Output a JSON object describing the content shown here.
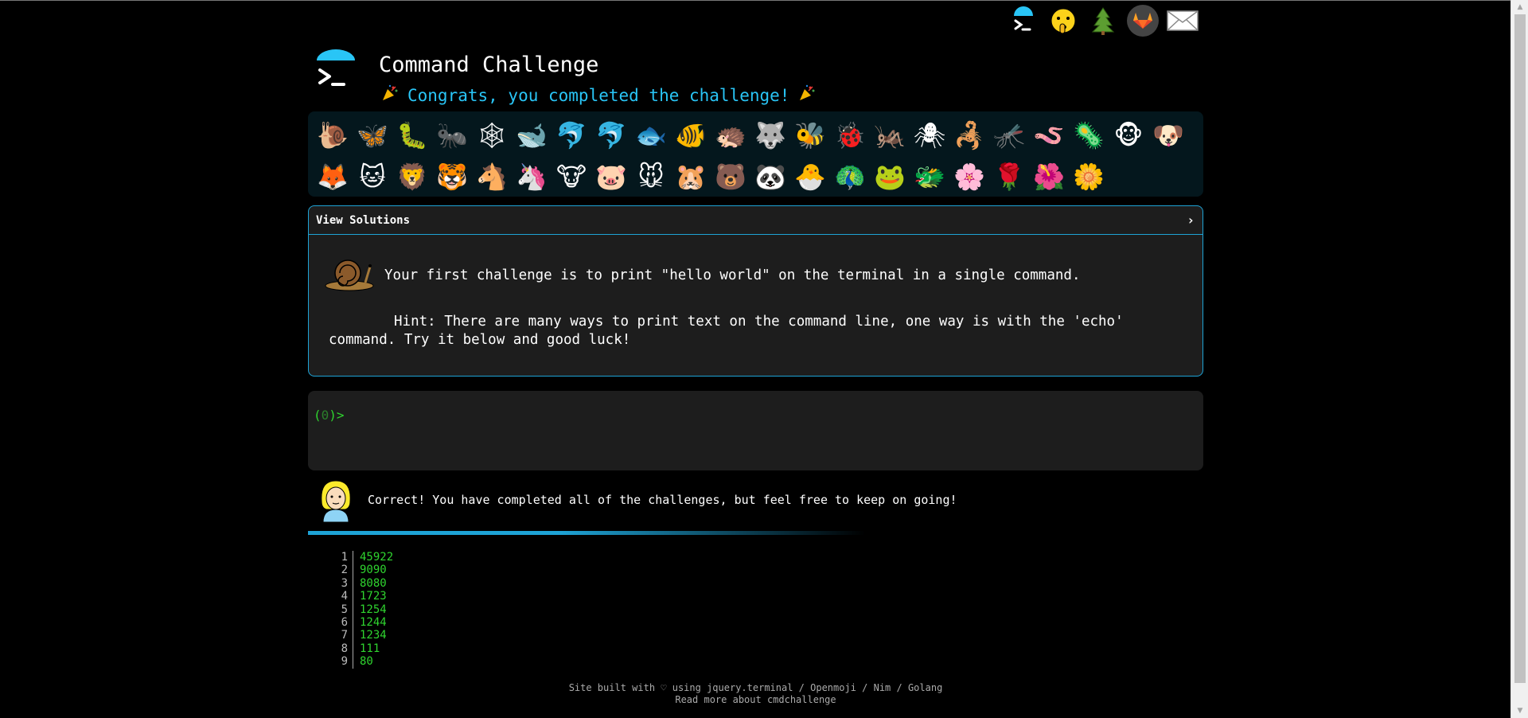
{
  "header": {
    "title": "Command Challenge",
    "subtitle": "Congrats, you completed the challenge!"
  },
  "top_links": [
    {
      "name": "terminal-icon"
    },
    {
      "name": "shushing-face-icon"
    },
    {
      "name": "evergreen-tree-icon"
    },
    {
      "name": "gitlab-icon"
    },
    {
      "name": "envelope-icon"
    }
  ],
  "animals": [
    "🐌",
    "🦋",
    "🐛",
    "🐜",
    "🕸",
    "🐋",
    "🐬",
    "🐬",
    "🐟",
    "🐠",
    "🦔",
    "🐺",
    "🐝",
    "🐞",
    "🦗",
    "🕷",
    "🦂",
    "🦟",
    "🪱",
    "🦠",
    "🐵",
    "🐶",
    "🦊",
    "🐱",
    "🦁",
    "🐯",
    "🐴",
    "🦄",
    "🐮",
    "🐷",
    "🐭",
    "🐹",
    "🐻",
    "🐼",
    "🐣",
    "🦚",
    "🐸",
    "🐲",
    "🌸",
    "🌹",
    "🌺",
    "🌼"
  ],
  "solutions": {
    "label": "View Solutions",
    "chevron": "›"
  },
  "challenge": {
    "text": "Your first challenge is to print \"hello world\" on the terminal in a single command.",
    "hint": "Hint: There are many ways to print text on the command line, one way is with the 'echo' command. Try it below and good luck!"
  },
  "terminal": {
    "prompt_open": "(",
    "prompt_count": "0",
    "prompt_close": ")>"
  },
  "response": {
    "message": "Correct! You have completed all of the challenges, but feel free to keep on going!"
  },
  "leaderboard": {
    "ranks": [
      "1",
      "2",
      "3",
      "4",
      "5",
      "6",
      "7",
      "8",
      "9"
    ],
    "scores": [
      "45922",
      "9090",
      "8080",
      "1723",
      "1254",
      "1244",
      "1234",
      "111",
      "80"
    ]
  },
  "footer": {
    "line1": "Site built with ♡ using jquery.terminal / Openmoji / Nim / Golang",
    "line2": "Read more about cmdchallenge"
  },
  "colors": {
    "accent": "#1ea3d6",
    "subtitle": "#29c5f6",
    "terminal_green": "#2fd42f",
    "panel": "#1d1d1d",
    "emoji_panel": "#04171d"
  }
}
